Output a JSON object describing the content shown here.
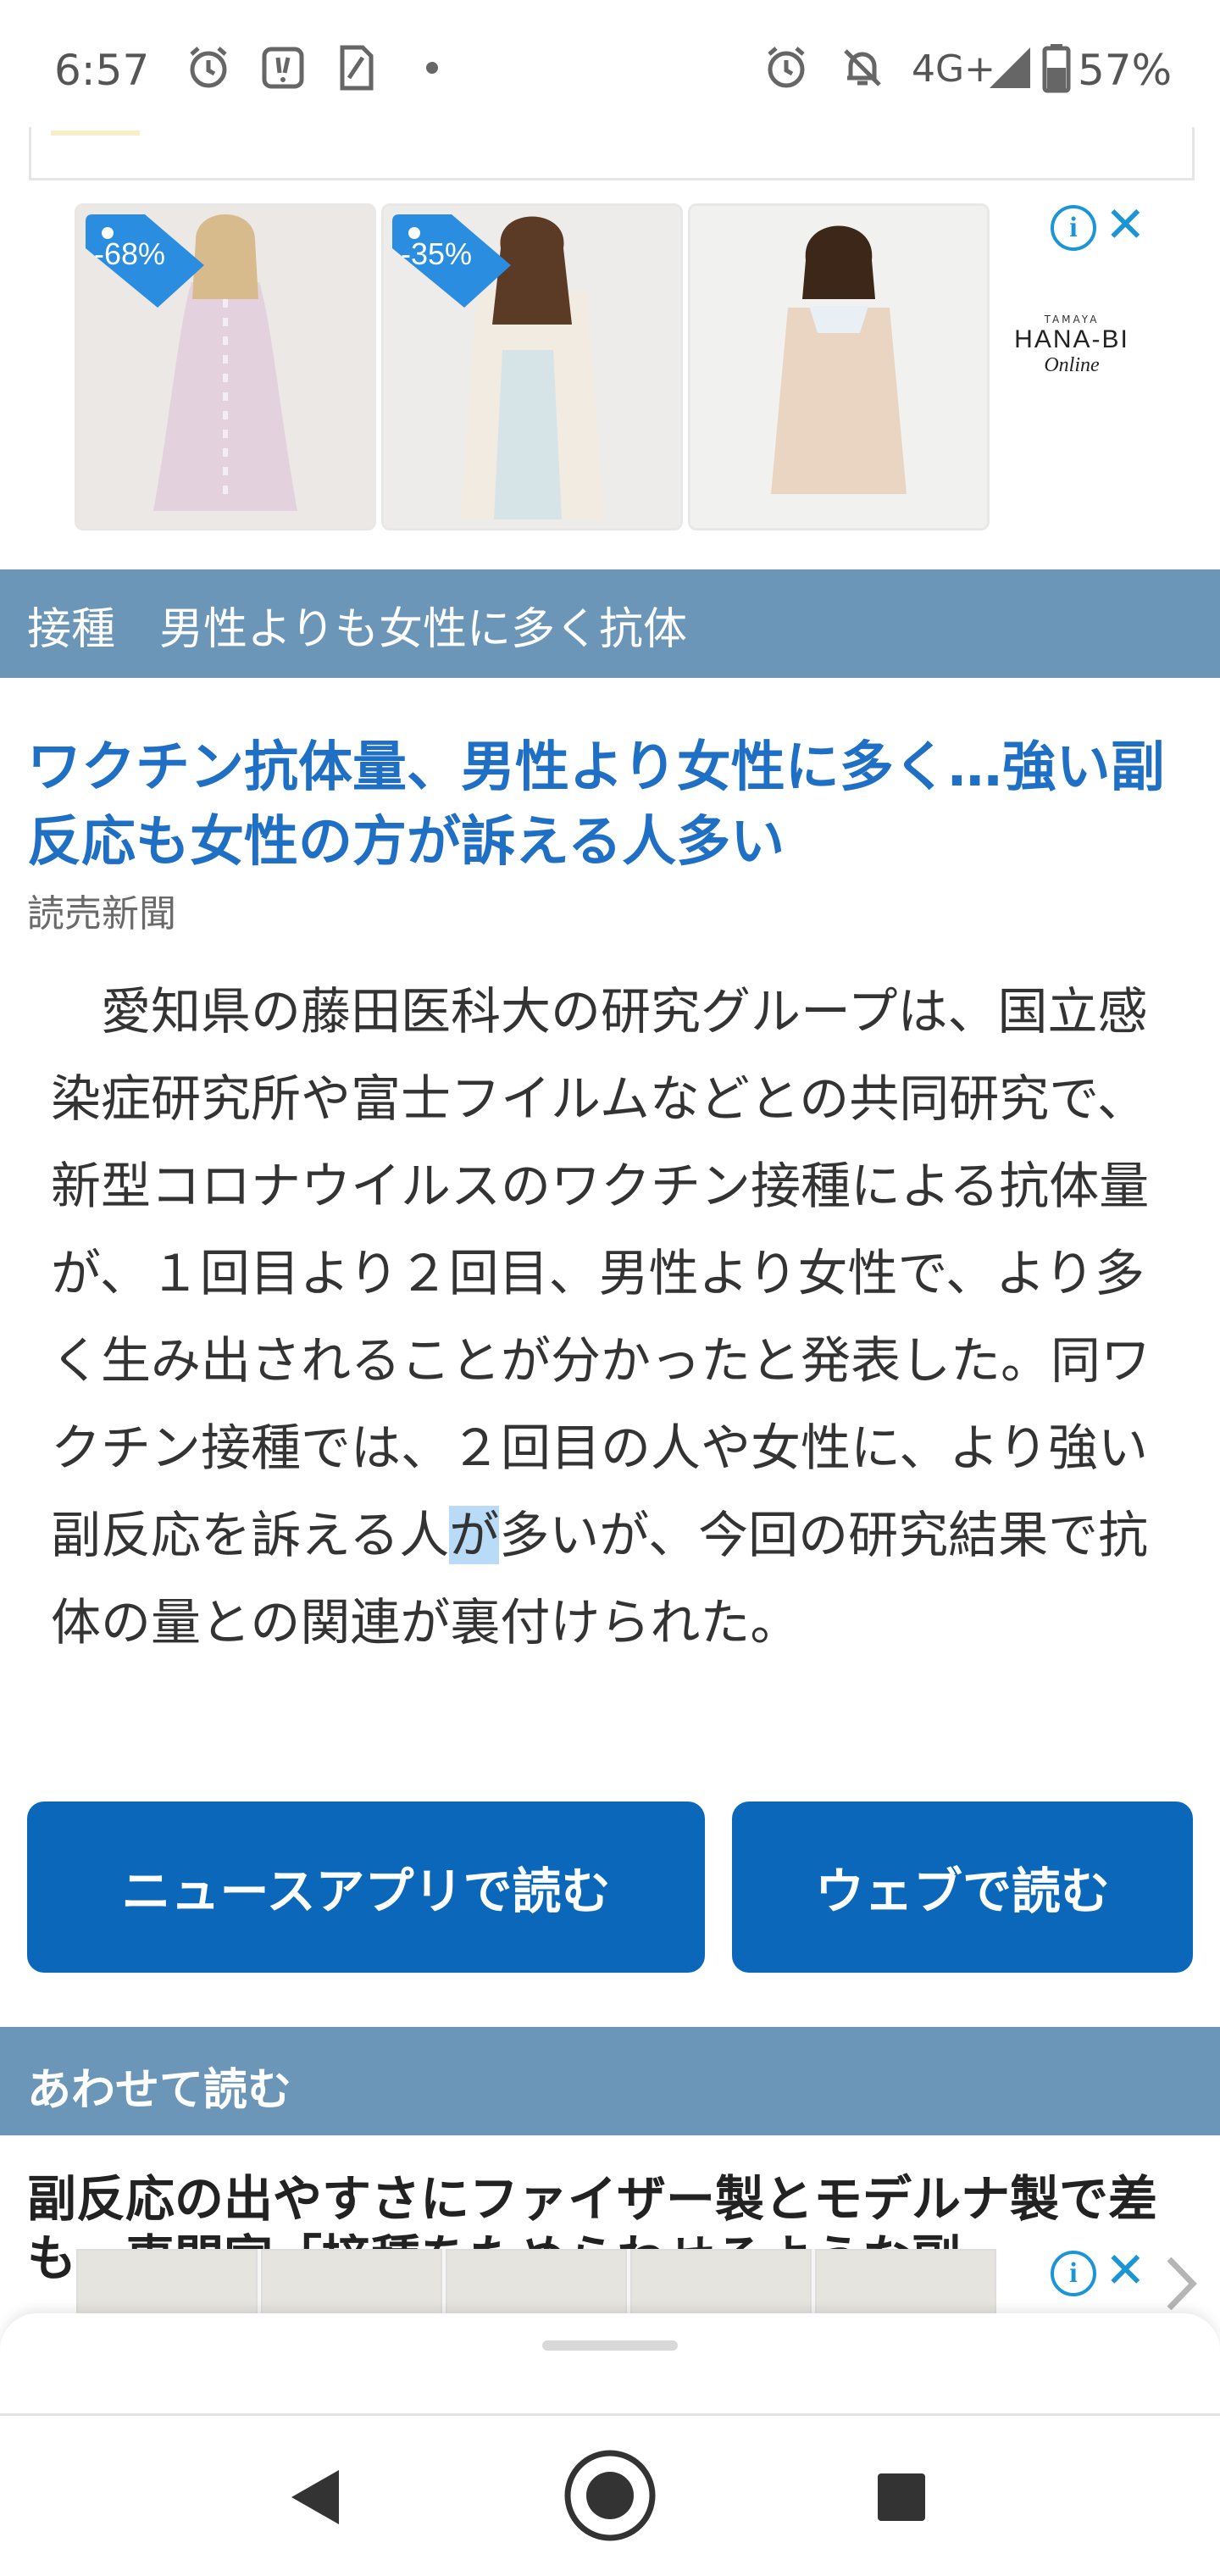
{
  "status_bar": {
    "time": "6:57",
    "network": "4G+",
    "battery": "57%",
    "icons_left": [
      "alarm-icon",
      "notification-app-icon",
      "sim-icon",
      "dot-icon"
    ],
    "icons_right": [
      "alarm-icon",
      "do-not-disturb-icon",
      "signal-icon",
      "battery-icon"
    ]
  },
  "ad": {
    "tags": [
      "-68%",
      "-35%"
    ],
    "brand": {
      "small": "TAMAYA",
      "main": "HANA-BI",
      "script": "Online"
    },
    "info_label": "i",
    "close_label": "✕"
  },
  "topic": {
    "label": "接種　男性よりも女性に多く抗体"
  },
  "article": {
    "headline": "ワクチン抗体量、男性より女性に多く…強い副反応も女性の方が訴える人多い",
    "source": "読売新聞",
    "body_before": "　愛知県の藤田医科大の研究グループは、国立感染症研究所や富士フイルムなどとの共同研究で、新型コロナウイルスのワクチン接種による抗体量が、１回目より２回目、男性より女性で、より多く生み出されることが分かったと発表した。同ワクチン接種では、２回目の人や女性に、より強い副反応を訴える人",
    "body_highlight": "が",
    "body_after": "多いが、今回の研究結果で抗体の量との関連が裏付けられた。"
  },
  "buttons": {
    "read_in_app": "ニュースアプリで読む",
    "read_on_web": "ウェブで読む"
  },
  "related": {
    "header": "あわせて読む",
    "first_item": "副反応の出やすさにファイザー製とモデルナ製で差も…専門家「接種をためらわせるような副"
  },
  "colors": {
    "accent_blue": "#0a67ba",
    "section_bar": "#6b96b8",
    "headline_blue": "#1f6fc5",
    "ad_tag": "#2a8de0"
  }
}
